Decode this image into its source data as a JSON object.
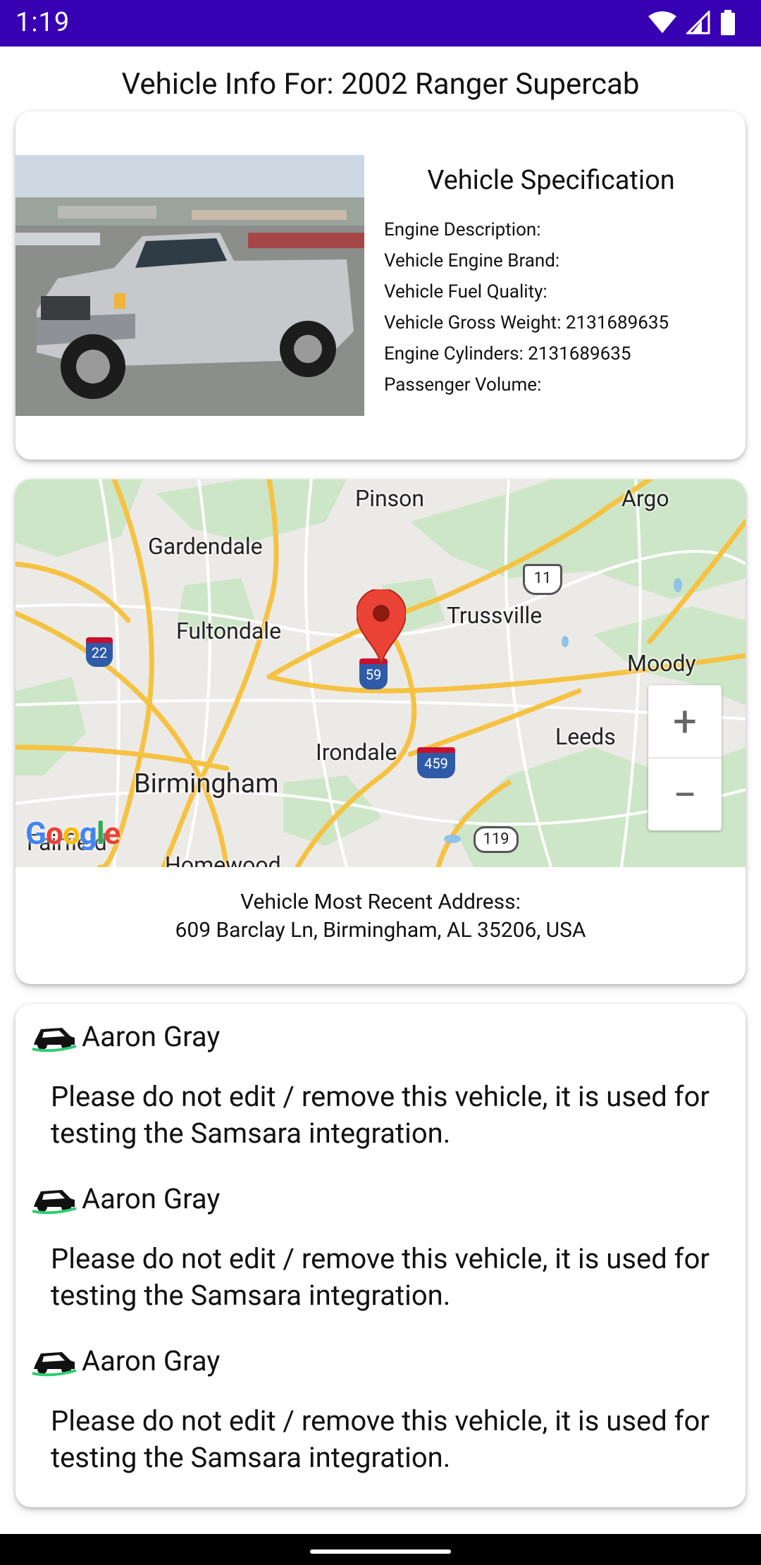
{
  "status_bar": {
    "time": "1:19"
  },
  "page": {
    "title": "Vehicle Info For: 2002 Ranger Supercab"
  },
  "spec": {
    "title": "Vehicle Specification",
    "rows": [
      "Engine Description:",
      "Vehicle Engine Brand:",
      "Vehicle Fuel Quality:",
      "Vehicle Gross Weight: 2131689635",
      "Engine Cylinders: 2131689635",
      "Passenger Volume:"
    ]
  },
  "map": {
    "labels": {
      "pinson": "Pinson",
      "argo": "Argo",
      "gardendale": "Gardendale",
      "fultondale": "Fultondale",
      "trussville": "Trussville",
      "moody": "Moody",
      "irondale": "Irondale",
      "leeds": "Leeds",
      "birmingham": "Birmingham",
      "fairfield": "Fairfield",
      "homewood": "Homewood"
    },
    "shields": {
      "i22": "22",
      "us11": "11",
      "i59": "59",
      "i459": "459",
      "us119": "119"
    },
    "zoom_in": "+",
    "zoom_out": "−",
    "attribution": "Google"
  },
  "address": {
    "label": "Vehicle Most Recent Address:",
    "value": "609 Barclay Ln, Birmingham, AL 35206, USA"
  },
  "notes": [
    {
      "author": "Aaron Gray",
      "text": "Please do not edit / remove this vehicle, it is used for testing the Samsara integration."
    },
    {
      "author": "Aaron Gray",
      "text": "Please do not edit / remove this vehicle, it is used for testing the Samsara integration."
    },
    {
      "author": "Aaron Gray",
      "text": "Please do not edit / remove this vehicle, it is used for testing the Samsara integration."
    }
  ],
  "colors": {
    "status_bar": "#3700b3",
    "pin": "#ea4335",
    "highway": "#f5c242",
    "green_area": "#cde6c7",
    "car_icon_accent": "#2ecc71"
  }
}
